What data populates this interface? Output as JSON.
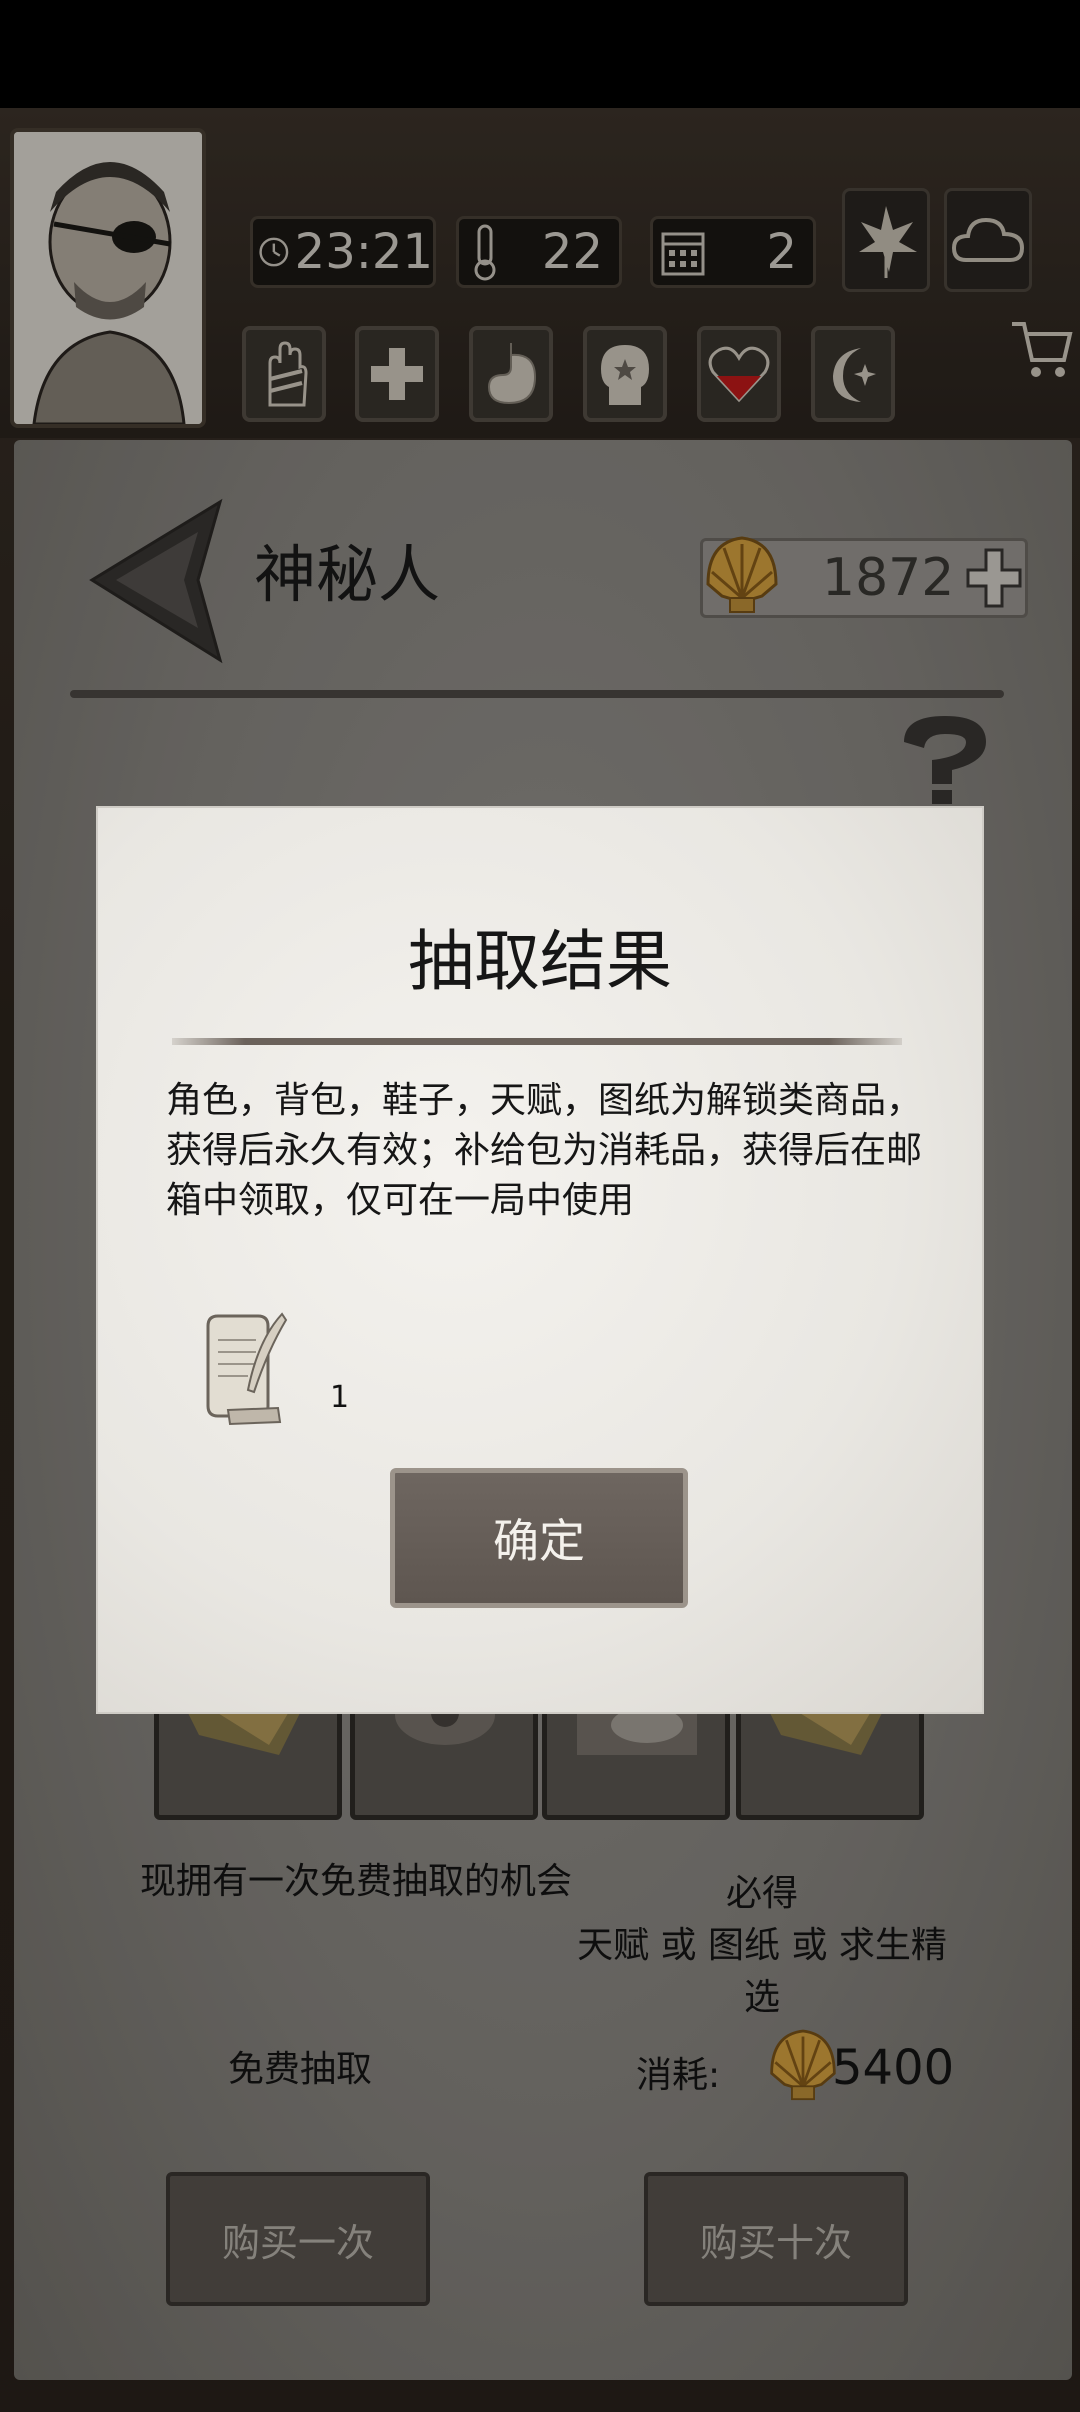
{
  "hud": {
    "time": "23:21",
    "temperature": "22",
    "day": "2"
  },
  "shop": {
    "title": "神秘人",
    "currency_amount": "1872",
    "free_chance_text": "现拥有一次免费抽取的机会",
    "guarantee_line1": "必得",
    "guarantee_line2": "天赋 或 图纸 或 求生精选",
    "free_draw_label": "免费抽取",
    "cost_label": "消耗:",
    "cost_amount": "5400",
    "buy_once_label": "购买一次",
    "buy_ten_label": "购买十次"
  },
  "modal": {
    "title": "抽取结果",
    "description": "角色，背包，鞋子，天赋，图纸为解锁类商品，获得后永久有效；补给包为消耗品，获得后在邮箱中领取，仅可在一局中使用",
    "reward_count": "1",
    "confirm_label": "确定"
  },
  "colors": {
    "modal_bg": "#ecebe7",
    "button_bg": "#655d57",
    "panel_bg": "#8d8a85",
    "shell_gold": "#d9a441"
  }
}
